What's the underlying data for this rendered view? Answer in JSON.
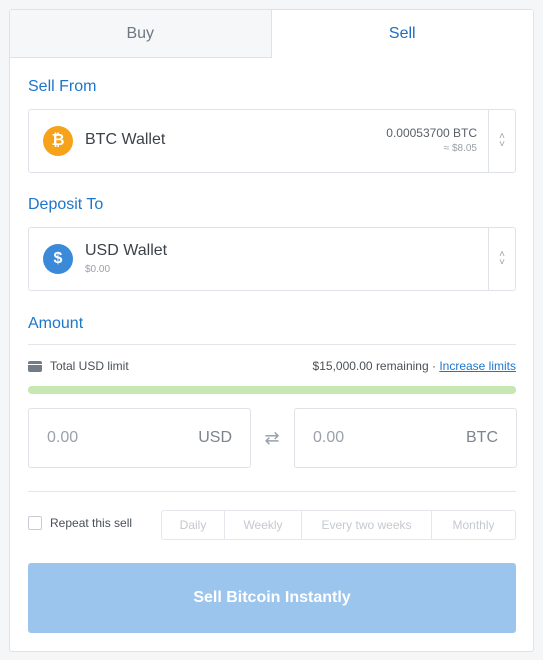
{
  "tabs": {
    "buy": "Buy",
    "sell": "Sell"
  },
  "sell_from": {
    "title": "Sell From",
    "wallet_name": "BTC Wallet",
    "balance": "0.00053700 BTC",
    "fiat_value": "≈ $8.05",
    "icon": "bitcoin-icon",
    "icon_color": "#f7a21b"
  },
  "deposit_to": {
    "title": "Deposit To",
    "wallet_name": "USD Wallet",
    "balance": "$0.00",
    "icon": "dollar-icon",
    "icon_color": "#3a8ad9"
  },
  "amount": {
    "title": "Amount",
    "limit_label": "Total USD limit",
    "remaining": "$15,000.00 remaining ·",
    "increase_link": "Increase limits",
    "limit_remaining_fraction": 1.0,
    "usd_value": "0.00",
    "usd_currency": "USD",
    "btc_value": "0.00",
    "btc_currency": "BTC"
  },
  "repeat": {
    "label": "Repeat this sell",
    "options": [
      "Daily",
      "Weekly",
      "Every two weeks",
      "Monthly"
    ]
  },
  "cta": {
    "label": "Sell Bitcoin Instantly",
    "color": "#9cc5ee"
  },
  "colors": {
    "accent": "#1d76c9",
    "progress": "#c7e7b3"
  }
}
